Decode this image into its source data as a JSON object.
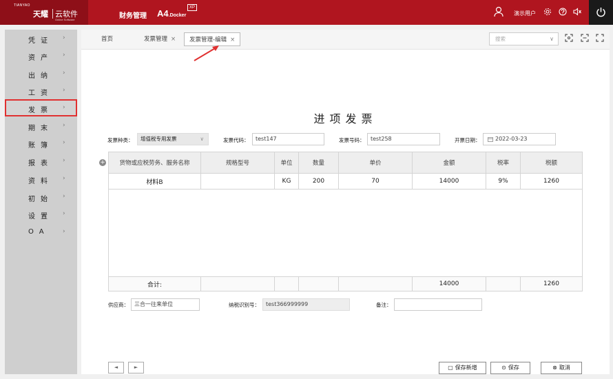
{
  "topbar": {
    "logo_small": "TIANYAO",
    "logo_main": "天耀",
    "logo_cloud": "云软件",
    "logo_sub": "Online Software",
    "app_title": "财务管理",
    "product": "A4",
    "product_sub": ".Docker",
    "product_badge": "XP",
    "user_name": "演示用户"
  },
  "sidebar": {
    "items": [
      {
        "label": "凭证"
      },
      {
        "label": "资产"
      },
      {
        "label": "出纳"
      },
      {
        "label": "工资"
      },
      {
        "label": "发票"
      },
      {
        "label": "期末"
      },
      {
        "label": "账簿"
      },
      {
        "label": "报表"
      },
      {
        "label": "资料"
      },
      {
        "label": "初始"
      },
      {
        "label": "设置"
      },
      {
        "label": "OA"
      }
    ],
    "chevron": "›"
  },
  "tabs": {
    "home": "首页",
    "invoice_mgmt": "发票管理",
    "invoice_edit": "发票管理-编辑",
    "close": "×"
  },
  "search": {
    "placeholder": "搜索",
    "arrow": "∨"
  },
  "form": {
    "title": "进项发票",
    "type_label": "发票种类：",
    "type_value": "增值税专用发票",
    "code_label": "发票代码：",
    "code_value": "test147",
    "number_label": "发票号码：",
    "number_value": "test258",
    "date_label": "开票日期：",
    "date_value": "2022-03-23",
    "supplier_label": "供应商：",
    "supplier_value": "三合一往来单位",
    "taxid_label": "纳税识别号：",
    "taxid_value": "test366999999",
    "remark_label": "备注：",
    "remark_value": ""
  },
  "table": {
    "headers": [
      "货物或应税劳务、服务名称",
      "规格型号",
      "单位",
      "数量",
      "单价",
      "金额",
      "税率",
      "税额"
    ],
    "rows": [
      [
        "材料B",
        "",
        "KG",
        "200",
        "70",
        "14000",
        "9%",
        "1260"
      ]
    ],
    "total_label": "合计:",
    "total_amount": "14000",
    "total_tax": "1260"
  },
  "buttons": {
    "prev": "◄",
    "next": "►",
    "save_new": "保存新增",
    "save": "保存",
    "cancel": "取消"
  },
  "colors": {
    "brand": "#b0151f",
    "highlight": "#e03030"
  }
}
